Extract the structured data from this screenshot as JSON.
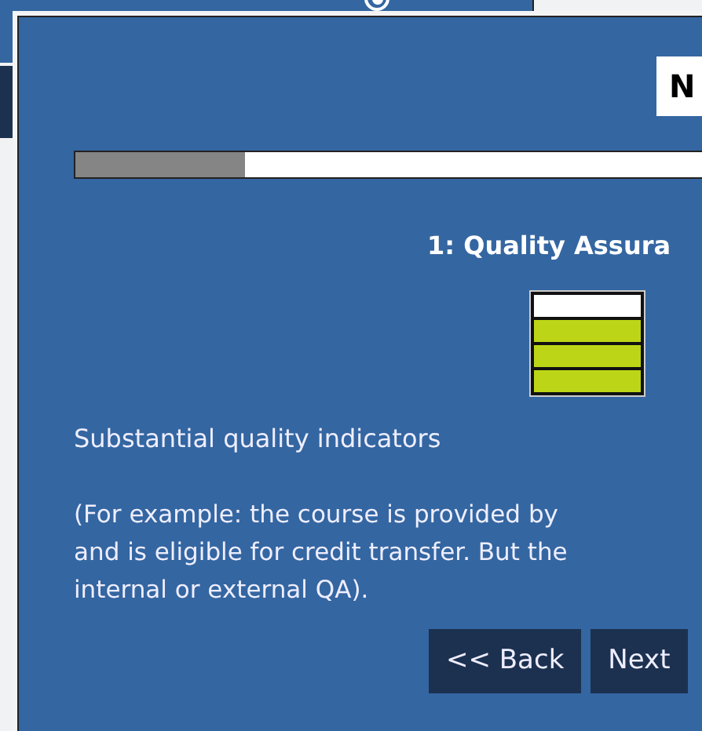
{
  "background_page": {
    "radio_selected": true
  },
  "dialog": {
    "corner_button": "N",
    "progress": {
      "level": 0.23
    },
    "heading": "1: Quality Assura",
    "rating": {
      "level": 0.75
    },
    "rating_label": "Substantial quality indicators",
    "example_lines": [
      "(For example: the course is provided by",
      "and is eligible for credit transfer. But the",
      "internal or external QA)."
    ],
    "buttons": [
      {
        "label": "<< Back"
      },
      {
        "label": "Next"
      }
    ]
  }
}
